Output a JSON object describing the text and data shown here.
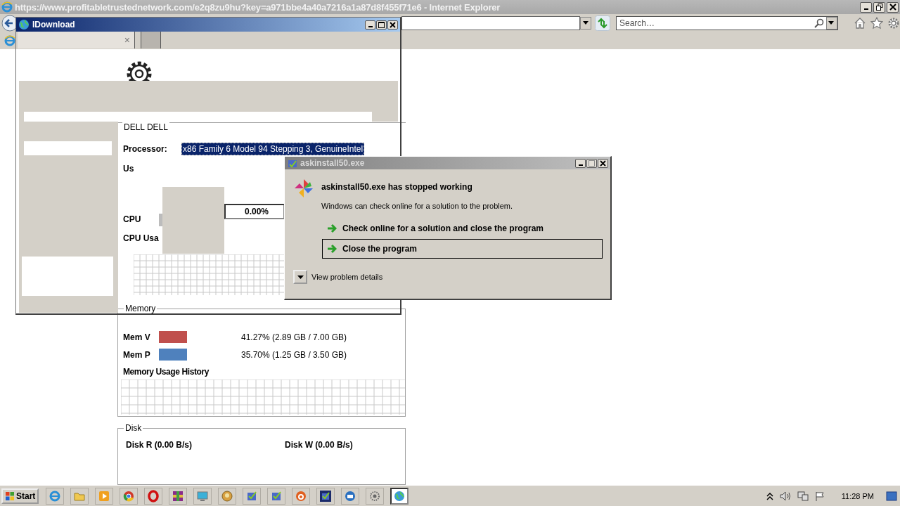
{
  "browser": {
    "title": "https://www.profitabletrustednetwork.com/e2q8zu9hu?key=a971bbe4a40a7216a1a87d8f455f71e6 - Internet Explorer",
    "search": {
      "placeholder": "Search…"
    }
  },
  "monitor": {
    "group_title": "DELL DELL",
    "processor_label": "Processor:",
    "processor_value": "x86 Family 6 Model 94 Stepping 3, GenuineIntel",
    "processor_selected": true,
    "usage_label": "Us",
    "cpu_label": "CPU",
    "cpu_reading": "0.00%",
    "cpu_history_label": "CPU Usa",
    "memory": {
      "title": "Memory",
      "meters": [
        {
          "name": "Mem V",
          "color": "#c0504d",
          "reading": "41.27% (2.89 GB / 7.00 GB)"
        },
        {
          "name": "Mem P",
          "color": "#4f81bd",
          "reading": "35.70% (1.25 GB / 3.50 GB)"
        }
      ],
      "history_label": "Memory Usage History"
    },
    "disk": {
      "title": "Disk",
      "read": "Disk R (0.00 B/s)",
      "write": "Disk W (0.00 B/s)"
    }
  },
  "idownload": {
    "title": "IDownload",
    "tabs": [
      {
        "close": "×",
        "selected": true
      },
      {
        "selected": false
      }
    ]
  },
  "dialog": {
    "title": "askinstall50.exe",
    "heading": "askinstall50.exe has stopped working",
    "message": "Windows can check online for a solution to the problem.",
    "options": [
      {
        "label": "Check online for a solution and close the program",
        "selected": false
      },
      {
        "label": "Close the program",
        "selected": true
      }
    ],
    "details": "View problem details"
  },
  "taskbar": {
    "start": "Start",
    "tasks": [
      {
        "kind": "ie",
        "selected": false
      },
      {
        "kind": "folder",
        "selected": false
      },
      {
        "kind": "media",
        "selected": false
      },
      {
        "kind": "chrome",
        "selected": false
      },
      {
        "kind": "opera",
        "selected": false
      },
      {
        "kind": "archive",
        "selected": false
      },
      {
        "kind": "screen",
        "selected": false
      },
      {
        "kind": "badge",
        "selected": false
      },
      {
        "kind": "setup",
        "selected": false
      },
      {
        "kind": "setup",
        "selected": false
      },
      {
        "kind": "orange",
        "selected": false
      },
      {
        "kind": "darksetup",
        "selected": false
      },
      {
        "kind": "printer",
        "selected": false
      },
      {
        "kind": "dots",
        "selected": false
      },
      {
        "kind": "globe",
        "selected": true
      }
    ],
    "clock": "11:28 PM"
  }
}
